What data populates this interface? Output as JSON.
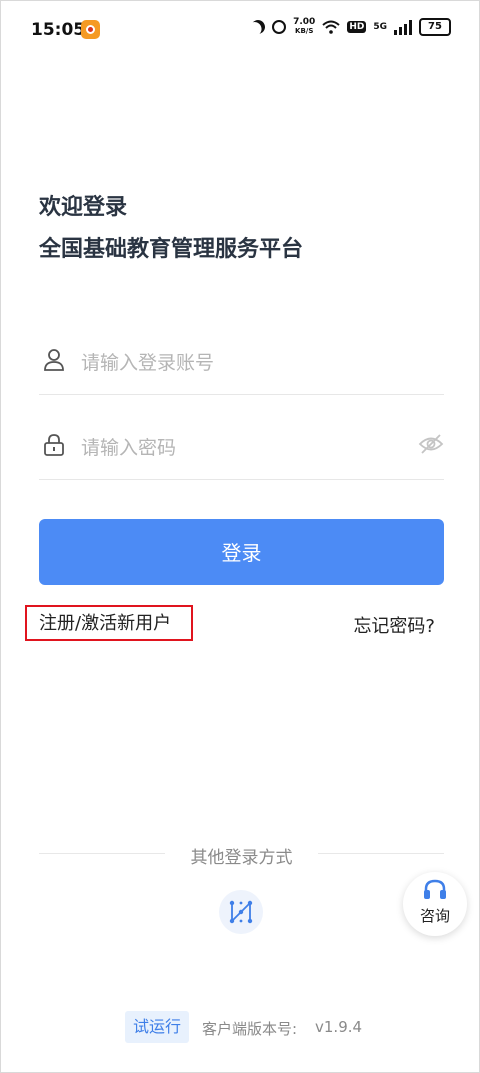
{
  "status_bar": {
    "time": "15:05",
    "speed_value": "7.00",
    "speed_unit": "KB/S",
    "hd": "HD",
    "network": "5G",
    "battery": "75",
    "icons": [
      "app-notification-icon",
      "moon-icon",
      "alarm-icon",
      "wifi-icon",
      "signal-icon",
      "battery-icon"
    ]
  },
  "header": {
    "welcome": "欢迎登录",
    "platform": "全国基础教育管理服务平台"
  },
  "form": {
    "account_placeholder": "请输入登录账号",
    "password_placeholder": "请输入密码",
    "account_icon": "user-icon",
    "password_icon": "lock-icon",
    "toggle_icon": "eye-hidden-icon"
  },
  "actions": {
    "login_label": "登录",
    "register_label": "注册/激活新用户",
    "forgot_label": "忘记密码?"
  },
  "other_login": {
    "label": "其他登录方式",
    "method_icon": "pattern-lock-icon"
  },
  "consult": {
    "label": "咨询",
    "icon": "headset-icon"
  },
  "footer": {
    "trial_badge": "试运行",
    "version_label": "客户端版本号:",
    "version_value": "v1.9.4"
  },
  "colors": {
    "primary": "#4c8bf5",
    "highlight_border": "#e0141e",
    "title_text": "#2a3442"
  }
}
